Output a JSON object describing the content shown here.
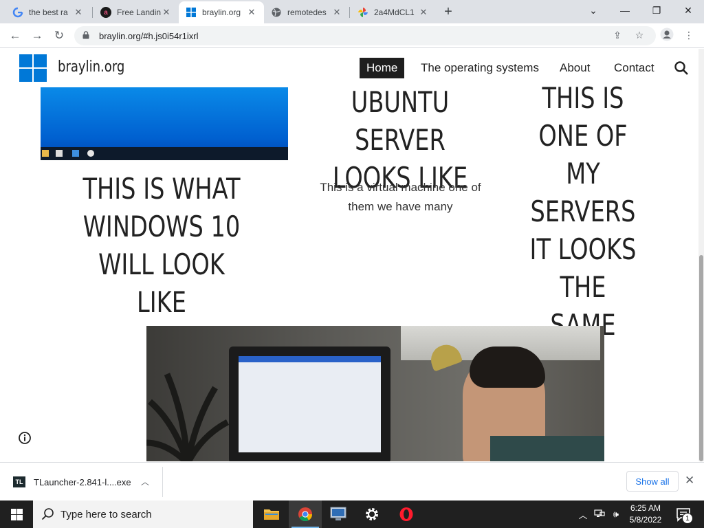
{
  "browser": {
    "tabs": [
      {
        "title": "the best ra",
        "icon": "google-g-icon"
      },
      {
        "title": "Free Landin",
        "icon": "landing-site-icon"
      },
      {
        "title": "braylin.org",
        "icon": "windows-logo-icon",
        "active": true
      },
      {
        "title": "remotedes",
        "icon": "globe-icon"
      },
      {
        "title": "2a4MdCL1",
        "icon": "pinwheel-icon"
      }
    ],
    "url": "braylin.org/#h.js0i54r1ixrl"
  },
  "site": {
    "name": "braylin.org",
    "nav": [
      {
        "label": "Home",
        "active": true
      },
      {
        "label": "The operating systems"
      },
      {
        "label": "About"
      },
      {
        "label": "Contact"
      }
    ],
    "col1_heading": "THIS IS WHAT WINDOWS 10 WILL LOOK LIKE",
    "col2_heading": "UBUNTU SERVER LOOKS LIKE",
    "col2_text": "This is a virtual machine one of them we have many",
    "col3_heading": "THIS IS ONE OF MY SERVERS IT LOOKS THE SAME"
  },
  "download_bar": {
    "file_name": "TLauncher-2.841-l....exe",
    "file_icon_text": "TL",
    "show_all": "Show all"
  },
  "taskbar": {
    "search_placeholder": "Type here to search",
    "time": "6:25 AM",
    "date": "5/8/2022",
    "notification_count": "1"
  },
  "colors": {
    "windows_blue": "#0078d7",
    "active_nav_bg": "#1e1e1e",
    "link_blue": "#1a73e8"
  }
}
